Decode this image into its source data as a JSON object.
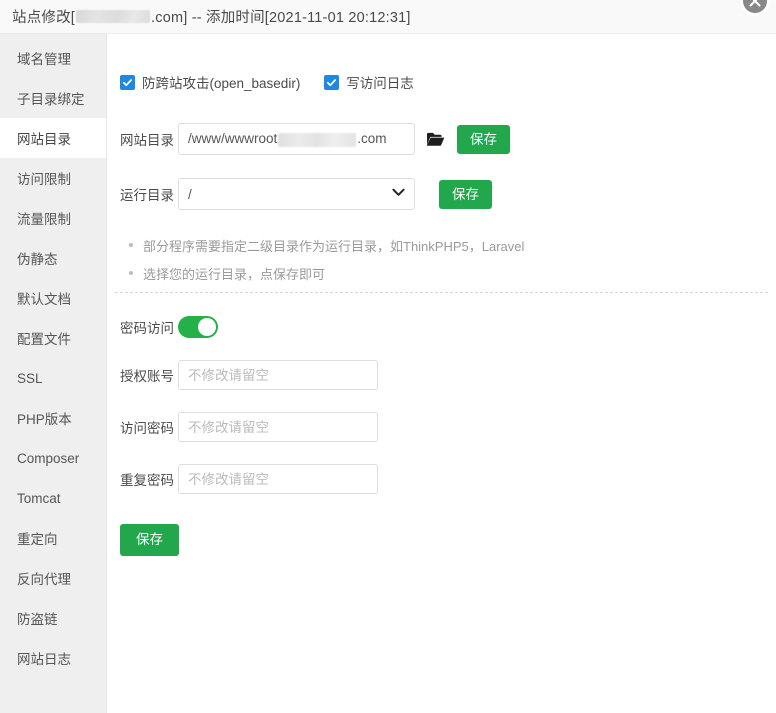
{
  "titlebar": {
    "prefix": "站点修改[",
    "domain_suffix": ".com] -- 添加时间[2021-11-01 20:12:31]",
    "close_icon": "close-icon"
  },
  "sidebar": {
    "items": [
      {
        "label": "域名管理",
        "active": false
      },
      {
        "label": "子目录绑定",
        "active": false
      },
      {
        "label": "网站目录",
        "active": true
      },
      {
        "label": "访问限制",
        "active": false
      },
      {
        "label": "流量限制",
        "active": false
      },
      {
        "label": "伪静态",
        "active": false
      },
      {
        "label": "默认文档",
        "active": false
      },
      {
        "label": "配置文件",
        "active": false
      },
      {
        "label": "SSL",
        "active": false
      },
      {
        "label": "PHP版本",
        "active": false
      },
      {
        "label": "Composer",
        "active": false
      },
      {
        "label": "Tomcat",
        "active": false
      },
      {
        "label": "重定向",
        "active": false
      },
      {
        "label": "反向代理",
        "active": false
      },
      {
        "label": "防盗链",
        "active": false
      },
      {
        "label": "网站日志",
        "active": false
      }
    ]
  },
  "main": {
    "checkboxes": [
      {
        "label": "防跨站攻击(open_basedir)",
        "checked": true
      },
      {
        "label": "写访问日志",
        "checked": true
      }
    ],
    "website_dir": {
      "label": "网站目录",
      "value_prefix": "/www/wwwroot",
      "value_suffix": ".com",
      "folder_icon": "folder-icon",
      "save_label": "保存"
    },
    "run_dir": {
      "label": "运行目录",
      "value": "/",
      "caret_icon": "chevron-down-icon",
      "save_label": "保存",
      "options": [
        "/"
      ]
    },
    "hints": [
      "部分程序需要指定二级目录作为运行目录，如ThinkPHP5，Laravel",
      "选择您的运行目录，点保存即可"
    ],
    "password_access": {
      "label": "密码访问",
      "enabled": true
    },
    "fields": [
      {
        "label": "授权账号",
        "value": "",
        "placeholder": "不修改请留空"
      },
      {
        "label": "访问密码",
        "value": "",
        "placeholder": "不修改请留空"
      },
      {
        "label": "重复密码",
        "value": "",
        "placeholder": "不修改请留空"
      }
    ],
    "save_label": "保存"
  },
  "colors": {
    "green": "#23a74c",
    "toggle_green": "#24b248",
    "checkbox_blue": "#1e88e5",
    "sidebar_bg": "#efefef"
  }
}
